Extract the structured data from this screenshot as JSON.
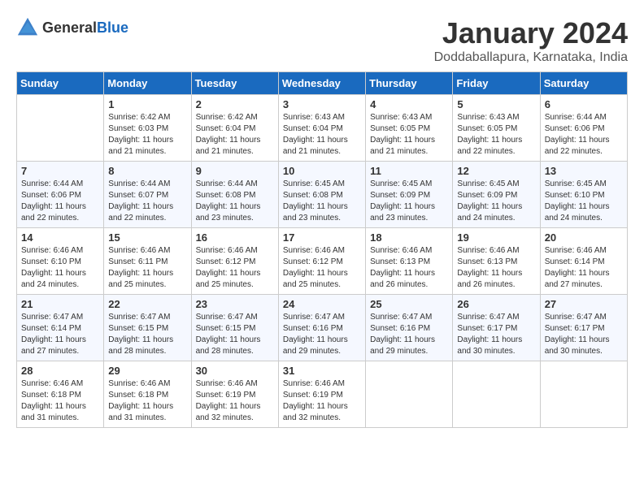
{
  "header": {
    "logo_general": "General",
    "logo_blue": "Blue",
    "title": "January 2024",
    "location": "Doddaballapura, Karnataka, India"
  },
  "weekdays": [
    "Sunday",
    "Monday",
    "Tuesday",
    "Wednesday",
    "Thursday",
    "Friday",
    "Saturday"
  ],
  "weeks": [
    [
      {
        "day": "",
        "sunrise": "",
        "sunset": "",
        "daylight": ""
      },
      {
        "day": "1",
        "sunrise": "Sunrise: 6:42 AM",
        "sunset": "Sunset: 6:03 PM",
        "daylight": "Daylight: 11 hours and 21 minutes."
      },
      {
        "day": "2",
        "sunrise": "Sunrise: 6:42 AM",
        "sunset": "Sunset: 6:04 PM",
        "daylight": "Daylight: 11 hours and 21 minutes."
      },
      {
        "day": "3",
        "sunrise": "Sunrise: 6:43 AM",
        "sunset": "Sunset: 6:04 PM",
        "daylight": "Daylight: 11 hours and 21 minutes."
      },
      {
        "day": "4",
        "sunrise": "Sunrise: 6:43 AM",
        "sunset": "Sunset: 6:05 PM",
        "daylight": "Daylight: 11 hours and 21 minutes."
      },
      {
        "day": "5",
        "sunrise": "Sunrise: 6:43 AM",
        "sunset": "Sunset: 6:05 PM",
        "daylight": "Daylight: 11 hours and 22 minutes."
      },
      {
        "day": "6",
        "sunrise": "Sunrise: 6:44 AM",
        "sunset": "Sunset: 6:06 PM",
        "daylight": "Daylight: 11 hours and 22 minutes."
      }
    ],
    [
      {
        "day": "7",
        "sunrise": "Sunrise: 6:44 AM",
        "sunset": "Sunset: 6:06 PM",
        "daylight": "Daylight: 11 hours and 22 minutes."
      },
      {
        "day": "8",
        "sunrise": "Sunrise: 6:44 AM",
        "sunset": "Sunset: 6:07 PM",
        "daylight": "Daylight: 11 hours and 22 minutes."
      },
      {
        "day": "9",
        "sunrise": "Sunrise: 6:44 AM",
        "sunset": "Sunset: 6:08 PM",
        "daylight": "Daylight: 11 hours and 23 minutes."
      },
      {
        "day": "10",
        "sunrise": "Sunrise: 6:45 AM",
        "sunset": "Sunset: 6:08 PM",
        "daylight": "Daylight: 11 hours and 23 minutes."
      },
      {
        "day": "11",
        "sunrise": "Sunrise: 6:45 AM",
        "sunset": "Sunset: 6:09 PM",
        "daylight": "Daylight: 11 hours and 23 minutes."
      },
      {
        "day": "12",
        "sunrise": "Sunrise: 6:45 AM",
        "sunset": "Sunset: 6:09 PM",
        "daylight": "Daylight: 11 hours and 24 minutes."
      },
      {
        "day": "13",
        "sunrise": "Sunrise: 6:45 AM",
        "sunset": "Sunset: 6:10 PM",
        "daylight": "Daylight: 11 hours and 24 minutes."
      }
    ],
    [
      {
        "day": "14",
        "sunrise": "Sunrise: 6:46 AM",
        "sunset": "Sunset: 6:10 PM",
        "daylight": "Daylight: 11 hours and 24 minutes."
      },
      {
        "day": "15",
        "sunrise": "Sunrise: 6:46 AM",
        "sunset": "Sunset: 6:11 PM",
        "daylight": "Daylight: 11 hours and 25 minutes."
      },
      {
        "day": "16",
        "sunrise": "Sunrise: 6:46 AM",
        "sunset": "Sunset: 6:12 PM",
        "daylight": "Daylight: 11 hours and 25 minutes."
      },
      {
        "day": "17",
        "sunrise": "Sunrise: 6:46 AM",
        "sunset": "Sunset: 6:12 PM",
        "daylight": "Daylight: 11 hours and 25 minutes."
      },
      {
        "day": "18",
        "sunrise": "Sunrise: 6:46 AM",
        "sunset": "Sunset: 6:13 PM",
        "daylight": "Daylight: 11 hours and 26 minutes."
      },
      {
        "day": "19",
        "sunrise": "Sunrise: 6:46 AM",
        "sunset": "Sunset: 6:13 PM",
        "daylight": "Daylight: 11 hours and 26 minutes."
      },
      {
        "day": "20",
        "sunrise": "Sunrise: 6:46 AM",
        "sunset": "Sunset: 6:14 PM",
        "daylight": "Daylight: 11 hours and 27 minutes."
      }
    ],
    [
      {
        "day": "21",
        "sunrise": "Sunrise: 6:47 AM",
        "sunset": "Sunset: 6:14 PM",
        "daylight": "Daylight: 11 hours and 27 minutes."
      },
      {
        "day": "22",
        "sunrise": "Sunrise: 6:47 AM",
        "sunset": "Sunset: 6:15 PM",
        "daylight": "Daylight: 11 hours and 28 minutes."
      },
      {
        "day": "23",
        "sunrise": "Sunrise: 6:47 AM",
        "sunset": "Sunset: 6:15 PM",
        "daylight": "Daylight: 11 hours and 28 minutes."
      },
      {
        "day": "24",
        "sunrise": "Sunrise: 6:47 AM",
        "sunset": "Sunset: 6:16 PM",
        "daylight": "Daylight: 11 hours and 29 minutes."
      },
      {
        "day": "25",
        "sunrise": "Sunrise: 6:47 AM",
        "sunset": "Sunset: 6:16 PM",
        "daylight": "Daylight: 11 hours and 29 minutes."
      },
      {
        "day": "26",
        "sunrise": "Sunrise: 6:47 AM",
        "sunset": "Sunset: 6:17 PM",
        "daylight": "Daylight: 11 hours and 30 minutes."
      },
      {
        "day": "27",
        "sunrise": "Sunrise: 6:47 AM",
        "sunset": "Sunset: 6:17 PM",
        "daylight": "Daylight: 11 hours and 30 minutes."
      }
    ],
    [
      {
        "day": "28",
        "sunrise": "Sunrise: 6:46 AM",
        "sunset": "Sunset: 6:18 PM",
        "daylight": "Daylight: 11 hours and 31 minutes."
      },
      {
        "day": "29",
        "sunrise": "Sunrise: 6:46 AM",
        "sunset": "Sunset: 6:18 PM",
        "daylight": "Daylight: 11 hours and 31 minutes."
      },
      {
        "day": "30",
        "sunrise": "Sunrise: 6:46 AM",
        "sunset": "Sunset: 6:19 PM",
        "daylight": "Daylight: 11 hours and 32 minutes."
      },
      {
        "day": "31",
        "sunrise": "Sunrise: 6:46 AM",
        "sunset": "Sunset: 6:19 PM",
        "daylight": "Daylight: 11 hours and 32 minutes."
      },
      {
        "day": "",
        "sunrise": "",
        "sunset": "",
        "daylight": ""
      },
      {
        "day": "",
        "sunrise": "",
        "sunset": "",
        "daylight": ""
      },
      {
        "day": "",
        "sunrise": "",
        "sunset": "",
        "daylight": ""
      }
    ]
  ]
}
